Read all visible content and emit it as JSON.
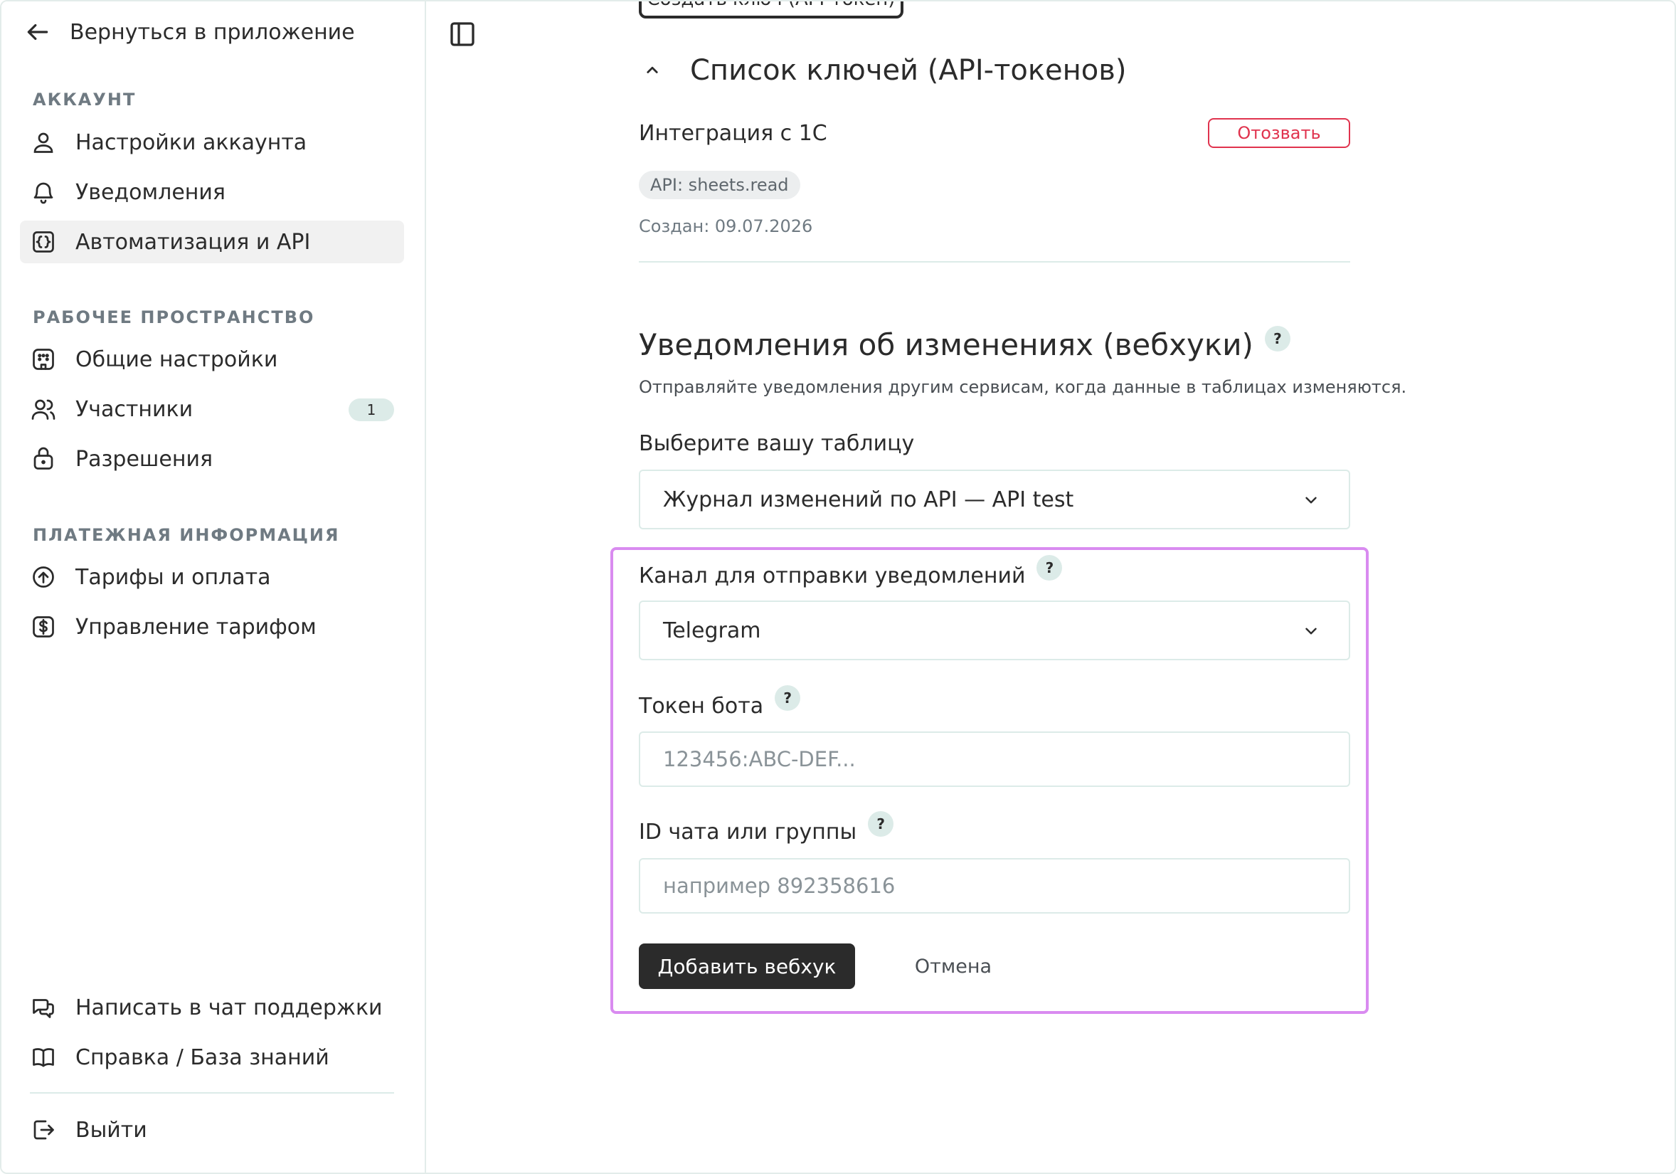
{
  "sidebar": {
    "back_label": "Вернуться в приложение",
    "sections": {
      "account": "АККАУНТ",
      "workspace": "РАБОЧЕЕ ПРОСТРАНСТВО",
      "billing": "ПЛАТЕЖНАЯ ИНФОРМАЦИЯ"
    },
    "items": {
      "account_settings": "Настройки аккаунта",
      "notifications": "Уведомления",
      "automation_api": "Автоматизация и API",
      "general_settings": "Общие настройки",
      "members": "Участники",
      "members_count": "1",
      "permissions": "Разрешения",
      "plans": "Тарифы и оплата",
      "plan_management": "Управление тарифом",
      "support_chat": "Написать в чат поддержки",
      "help": "Справка / База знаний",
      "logout": "Выйти"
    }
  },
  "keys": {
    "create_button": "Создать ключ (API-токен)",
    "title": "Список ключей (API-токенов)",
    "key_name": "Интеграция с 1С",
    "revoke_label": "Отозвать",
    "scope": "API: sheets.read",
    "created": "Создан: 09.07.2026"
  },
  "webhooks": {
    "title": "Уведомления об изменениях (вебхуки)",
    "description": "Отправляйте уведомления другим сервисам, когда данные в таблицах изменяются.",
    "table_label": "Выберите вашу таблицу",
    "table_value": "Журнал изменений по API — API test",
    "channel_label": "Канал для отправки уведомлений",
    "channel_value": "Telegram",
    "token_label": "Токен бота",
    "token_placeholder": "123456:ABC-DEF...",
    "chat_label": "ID чата или группы",
    "chat_placeholder": "например 892358616",
    "help_symbol": "?",
    "submit_label": "Добавить вебхук",
    "cancel_label": "Отмена"
  },
  "colors": {
    "accent_dark": "#2b2b2b",
    "danger": "#e0334e",
    "highlight": "#d98bf0",
    "badge_bg": "#dcebe8"
  }
}
